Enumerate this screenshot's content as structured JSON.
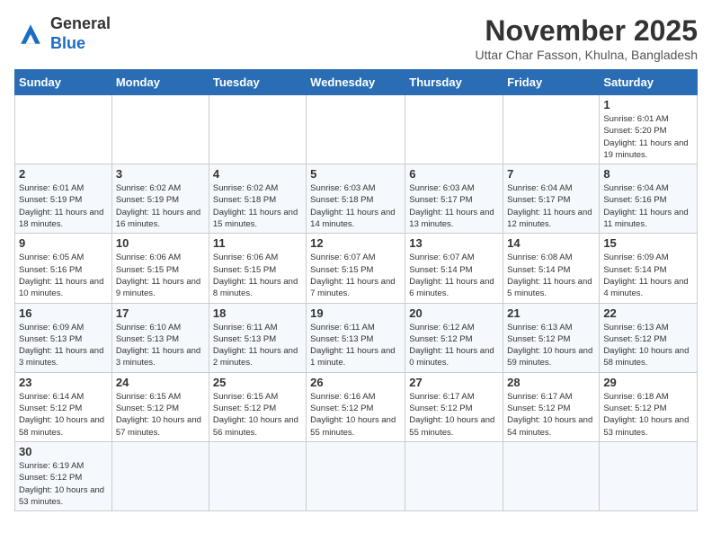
{
  "header": {
    "logo_general": "General",
    "logo_blue": "Blue",
    "month_title": "November 2025",
    "location": "Uttar Char Fasson, Khulna, Bangladesh"
  },
  "weekdays": [
    "Sunday",
    "Monday",
    "Tuesday",
    "Wednesday",
    "Thursday",
    "Friday",
    "Saturday"
  ],
  "weeks": [
    [
      {
        "day": "",
        "info": ""
      },
      {
        "day": "",
        "info": ""
      },
      {
        "day": "",
        "info": ""
      },
      {
        "day": "",
        "info": ""
      },
      {
        "day": "",
        "info": ""
      },
      {
        "day": "",
        "info": ""
      },
      {
        "day": "1",
        "info": "Sunrise: 6:01 AM\nSunset: 5:20 PM\nDaylight: 11 hours and 19 minutes."
      }
    ],
    [
      {
        "day": "2",
        "info": "Sunrise: 6:01 AM\nSunset: 5:19 PM\nDaylight: 11 hours and 18 minutes."
      },
      {
        "day": "3",
        "info": "Sunrise: 6:02 AM\nSunset: 5:19 PM\nDaylight: 11 hours and 16 minutes."
      },
      {
        "day": "4",
        "info": "Sunrise: 6:02 AM\nSunset: 5:18 PM\nDaylight: 11 hours and 15 minutes."
      },
      {
        "day": "5",
        "info": "Sunrise: 6:03 AM\nSunset: 5:18 PM\nDaylight: 11 hours and 14 minutes."
      },
      {
        "day": "6",
        "info": "Sunrise: 6:03 AM\nSunset: 5:17 PM\nDaylight: 11 hours and 13 minutes."
      },
      {
        "day": "7",
        "info": "Sunrise: 6:04 AM\nSunset: 5:17 PM\nDaylight: 11 hours and 12 minutes."
      },
      {
        "day": "8",
        "info": "Sunrise: 6:04 AM\nSunset: 5:16 PM\nDaylight: 11 hours and 11 minutes."
      }
    ],
    [
      {
        "day": "9",
        "info": "Sunrise: 6:05 AM\nSunset: 5:16 PM\nDaylight: 11 hours and 10 minutes."
      },
      {
        "day": "10",
        "info": "Sunrise: 6:06 AM\nSunset: 5:15 PM\nDaylight: 11 hours and 9 minutes."
      },
      {
        "day": "11",
        "info": "Sunrise: 6:06 AM\nSunset: 5:15 PM\nDaylight: 11 hours and 8 minutes."
      },
      {
        "day": "12",
        "info": "Sunrise: 6:07 AM\nSunset: 5:15 PM\nDaylight: 11 hours and 7 minutes."
      },
      {
        "day": "13",
        "info": "Sunrise: 6:07 AM\nSunset: 5:14 PM\nDaylight: 11 hours and 6 minutes."
      },
      {
        "day": "14",
        "info": "Sunrise: 6:08 AM\nSunset: 5:14 PM\nDaylight: 11 hours and 5 minutes."
      },
      {
        "day": "15",
        "info": "Sunrise: 6:09 AM\nSunset: 5:14 PM\nDaylight: 11 hours and 4 minutes."
      }
    ],
    [
      {
        "day": "16",
        "info": "Sunrise: 6:09 AM\nSunset: 5:13 PM\nDaylight: 11 hours and 3 minutes."
      },
      {
        "day": "17",
        "info": "Sunrise: 6:10 AM\nSunset: 5:13 PM\nDaylight: 11 hours and 3 minutes."
      },
      {
        "day": "18",
        "info": "Sunrise: 6:11 AM\nSunset: 5:13 PM\nDaylight: 11 hours and 2 minutes."
      },
      {
        "day": "19",
        "info": "Sunrise: 6:11 AM\nSunset: 5:13 PM\nDaylight: 11 hours and 1 minute."
      },
      {
        "day": "20",
        "info": "Sunrise: 6:12 AM\nSunset: 5:12 PM\nDaylight: 11 hours and 0 minutes."
      },
      {
        "day": "21",
        "info": "Sunrise: 6:13 AM\nSunset: 5:12 PM\nDaylight: 10 hours and 59 minutes."
      },
      {
        "day": "22",
        "info": "Sunrise: 6:13 AM\nSunset: 5:12 PM\nDaylight: 10 hours and 58 minutes."
      }
    ],
    [
      {
        "day": "23",
        "info": "Sunrise: 6:14 AM\nSunset: 5:12 PM\nDaylight: 10 hours and 58 minutes."
      },
      {
        "day": "24",
        "info": "Sunrise: 6:15 AM\nSunset: 5:12 PM\nDaylight: 10 hours and 57 minutes."
      },
      {
        "day": "25",
        "info": "Sunrise: 6:15 AM\nSunset: 5:12 PM\nDaylight: 10 hours and 56 minutes."
      },
      {
        "day": "26",
        "info": "Sunrise: 6:16 AM\nSunset: 5:12 PM\nDaylight: 10 hours and 55 minutes."
      },
      {
        "day": "27",
        "info": "Sunrise: 6:17 AM\nSunset: 5:12 PM\nDaylight: 10 hours and 55 minutes."
      },
      {
        "day": "28",
        "info": "Sunrise: 6:17 AM\nSunset: 5:12 PM\nDaylight: 10 hours and 54 minutes."
      },
      {
        "day": "29",
        "info": "Sunrise: 6:18 AM\nSunset: 5:12 PM\nDaylight: 10 hours and 53 minutes."
      }
    ],
    [
      {
        "day": "30",
        "info": "Sunrise: 6:19 AM\nSunset: 5:12 PM\nDaylight: 10 hours and 53 minutes."
      },
      {
        "day": "",
        "info": ""
      },
      {
        "day": "",
        "info": ""
      },
      {
        "day": "",
        "info": ""
      },
      {
        "day": "",
        "info": ""
      },
      {
        "day": "",
        "info": ""
      },
      {
        "day": "",
        "info": ""
      }
    ]
  ]
}
